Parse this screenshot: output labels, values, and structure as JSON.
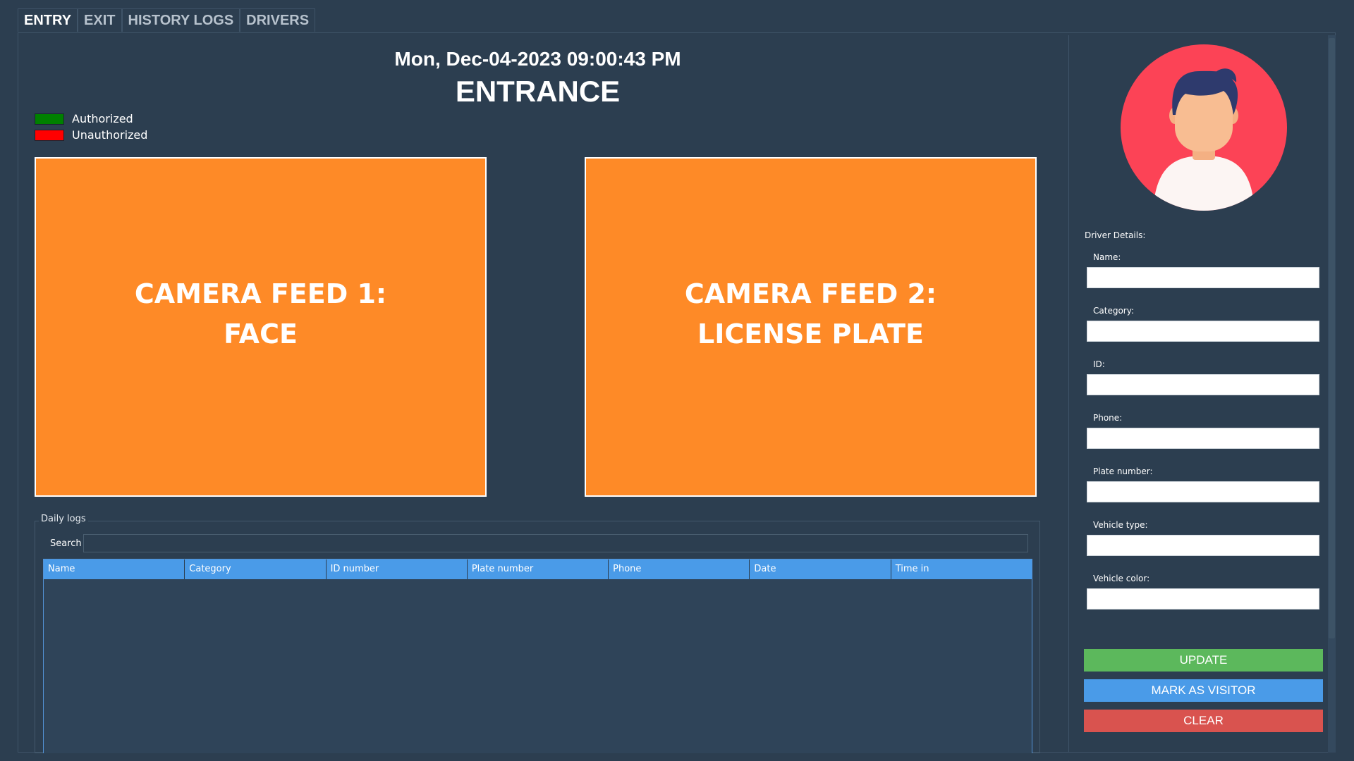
{
  "tabs": [
    {
      "label": "ENTRY",
      "active": true
    },
    {
      "label": "EXIT",
      "active": false
    },
    {
      "label": "HISTORY LOGS",
      "active": false
    },
    {
      "label": "DRIVERS",
      "active": false
    }
  ],
  "header": {
    "datetime": "Mon, Dec-04-2023 09:00:43 PM",
    "mode": "ENTRANCE"
  },
  "legend": [
    {
      "label": "Authorized",
      "color": "#008000"
    },
    {
      "label": "Unauthorized",
      "color": "#ff0000"
    }
  ],
  "camera_feeds": [
    {
      "label": "CAMERA FEED 1:\nFACE"
    },
    {
      "label": "CAMERA FEED 2:\nLICENSE PLATE"
    }
  ],
  "daily_logs": {
    "title": "Daily logs",
    "search_label": "Search",
    "search_value": "",
    "columns": [
      "Name",
      "Category",
      "ID number",
      "Plate number",
      "Phone",
      "Date",
      "Time in"
    ],
    "rows": []
  },
  "driver_details": {
    "title": "Driver Details:",
    "fields": [
      {
        "label": "Name:",
        "value": ""
      },
      {
        "label": "Category:",
        "value": ""
      },
      {
        "label": "ID:",
        "value": ""
      },
      {
        "label": "Phone:",
        "value": ""
      },
      {
        "label": "Plate number:",
        "value": ""
      },
      {
        "label": "Vehicle type:",
        "value": ""
      },
      {
        "label": "Vehicle color:",
        "value": ""
      }
    ]
  },
  "actions": {
    "update_label": "UPDATE",
    "visitor_label": "MARK AS VISITOR",
    "clear_label": "CLEAR"
  },
  "colors": {
    "background": "#2c3e50",
    "feed": "#fe8a27",
    "table_header": "#4a9be8",
    "update": "#5cb85c",
    "visitor": "#4a9be8",
    "clear": "#d9534f",
    "avatar_bg": "#fc4356"
  },
  "icons": {
    "avatar": "user-avatar-icon"
  }
}
